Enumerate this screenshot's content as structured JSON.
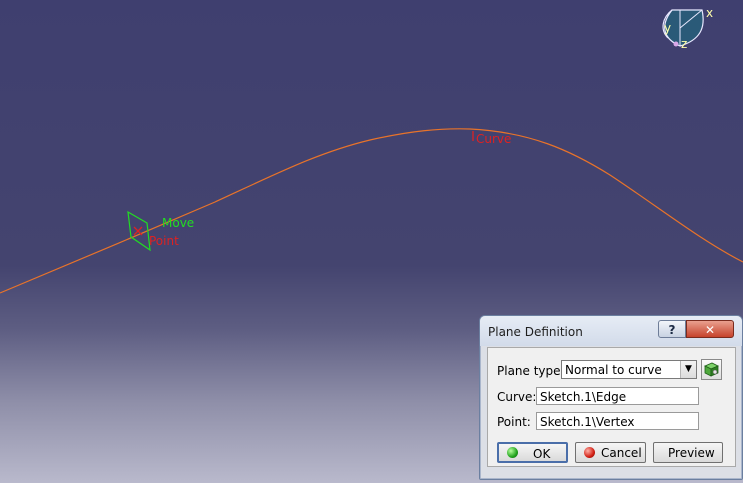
{
  "viewport": {
    "labels": {
      "curve": "Curve",
      "move": "Move",
      "point": "Point"
    },
    "compass_axes": {
      "x": "x",
      "y": "y",
      "z": "z"
    },
    "colors": {
      "curve": "#e8732a",
      "move_label": "#22dd22",
      "point_label": "#dd2222",
      "background_top": "#3f3f6f",
      "background_bottom": "#b9b9cc"
    }
  },
  "dialog": {
    "title": "Plane Definition",
    "help_label": "?",
    "close_label": "✕",
    "plane_type": {
      "label": "Plane type:",
      "value": "Normal to curve",
      "arrow": "▼"
    },
    "curve": {
      "label": "Curve:",
      "value": "Sketch.1\\Edge"
    },
    "point": {
      "label": "Point:",
      "value": "Sketch.1\\Vertex"
    },
    "buttons": {
      "ok": "OK",
      "cancel": "Cancel",
      "preview": "Preview"
    }
  }
}
